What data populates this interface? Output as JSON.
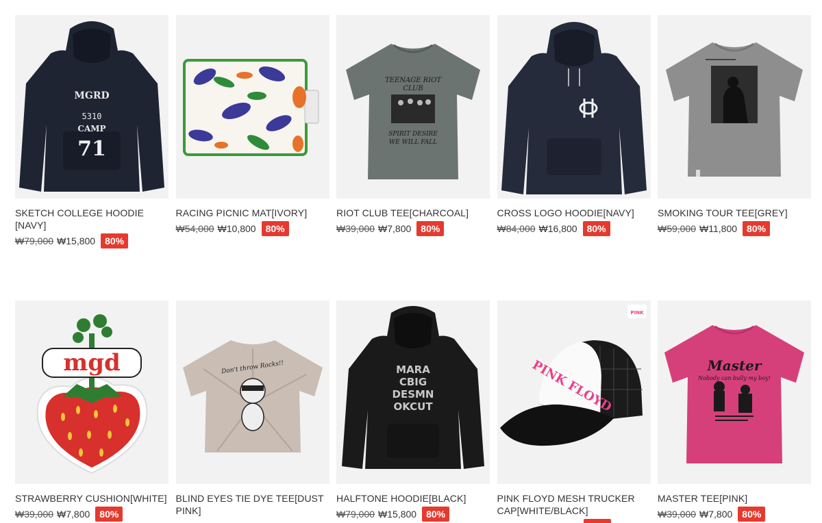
{
  "products": [
    {
      "name": "SKETCH COLLEGE HOODIE [NAVY]",
      "original_price": "₩79,000",
      "sale_price": "₩15,800",
      "discount": "80%",
      "image_icon": "navy-hoodie-icon",
      "print_text": [
        "MGRD",
        "5310",
        "CAMP",
        "71"
      ]
    },
    {
      "name": "RACING PICNIC MAT[IVORY]",
      "original_price": "₩54,000",
      "sale_price": "₩10,800",
      "discount": "80%",
      "image_icon": "picnic-mat-icon"
    },
    {
      "name": "RIOT CLUB TEE[CHARCOAL]",
      "original_price": "₩39,000",
      "sale_price": "₩7,800",
      "discount": "80%",
      "image_icon": "charcoal-tee-icon",
      "print_text": [
        "TEENAGE RIOT",
        "CLUB",
        "SPIRIT DESIRE",
        "WE WILL FALL"
      ]
    },
    {
      "name": "CROSS LOGO HOODIE[NAVY]",
      "original_price": "₩84,000",
      "sale_price": "₩16,800",
      "discount": "80%",
      "image_icon": "navy-hoodie-logo-icon"
    },
    {
      "name": "SMOKING TOUR TEE[GREY]",
      "original_price": "₩59,000",
      "sale_price": "₩11,800",
      "discount": "80%",
      "image_icon": "grey-tee-photo-icon"
    },
    {
      "name": "STRAWBERRY CUSHION[WHITE]",
      "original_price": "₩39,000",
      "sale_price": "₩7,800",
      "discount": "80%",
      "image_icon": "strawberry-cushion-icon",
      "print_text": [
        "mgd"
      ]
    },
    {
      "name": "BLIND EYES TIE DYE TEE[DUST PINK]",
      "original_price": "",
      "sale_price": "",
      "discount": "",
      "image_icon": "tie-dye-tee-icon",
      "print_text": [
        "Don't throw Rocks!!"
      ]
    },
    {
      "name": "HALFTONE HOODIE[BLACK]",
      "original_price": "₩79,000",
      "sale_price": "₩15,800",
      "discount": "80%",
      "image_icon": "black-hoodie-icon",
      "print_text": [
        "MARA",
        "CBIG",
        "DESMN",
        "OKCUT"
      ]
    },
    {
      "name": "PINK FLOYD MESH TRUCKER CAP[WHITE/BLACK]",
      "original_price": "",
      "sale_price": "",
      "discount": "",
      "image_icon": "trucker-cap-icon"
    },
    {
      "name": "MASTER TEE[PINK]",
      "original_price": "₩39,000",
      "sale_price": "₩7,800",
      "discount": "80%",
      "image_icon": "pink-tee-icon",
      "print_text": [
        "Master",
        "Nobody can bully my boy!"
      ]
    }
  ],
  "colors": {
    "badge": "#e53a2f",
    "thumb_bg": "#f2f2f2"
  }
}
